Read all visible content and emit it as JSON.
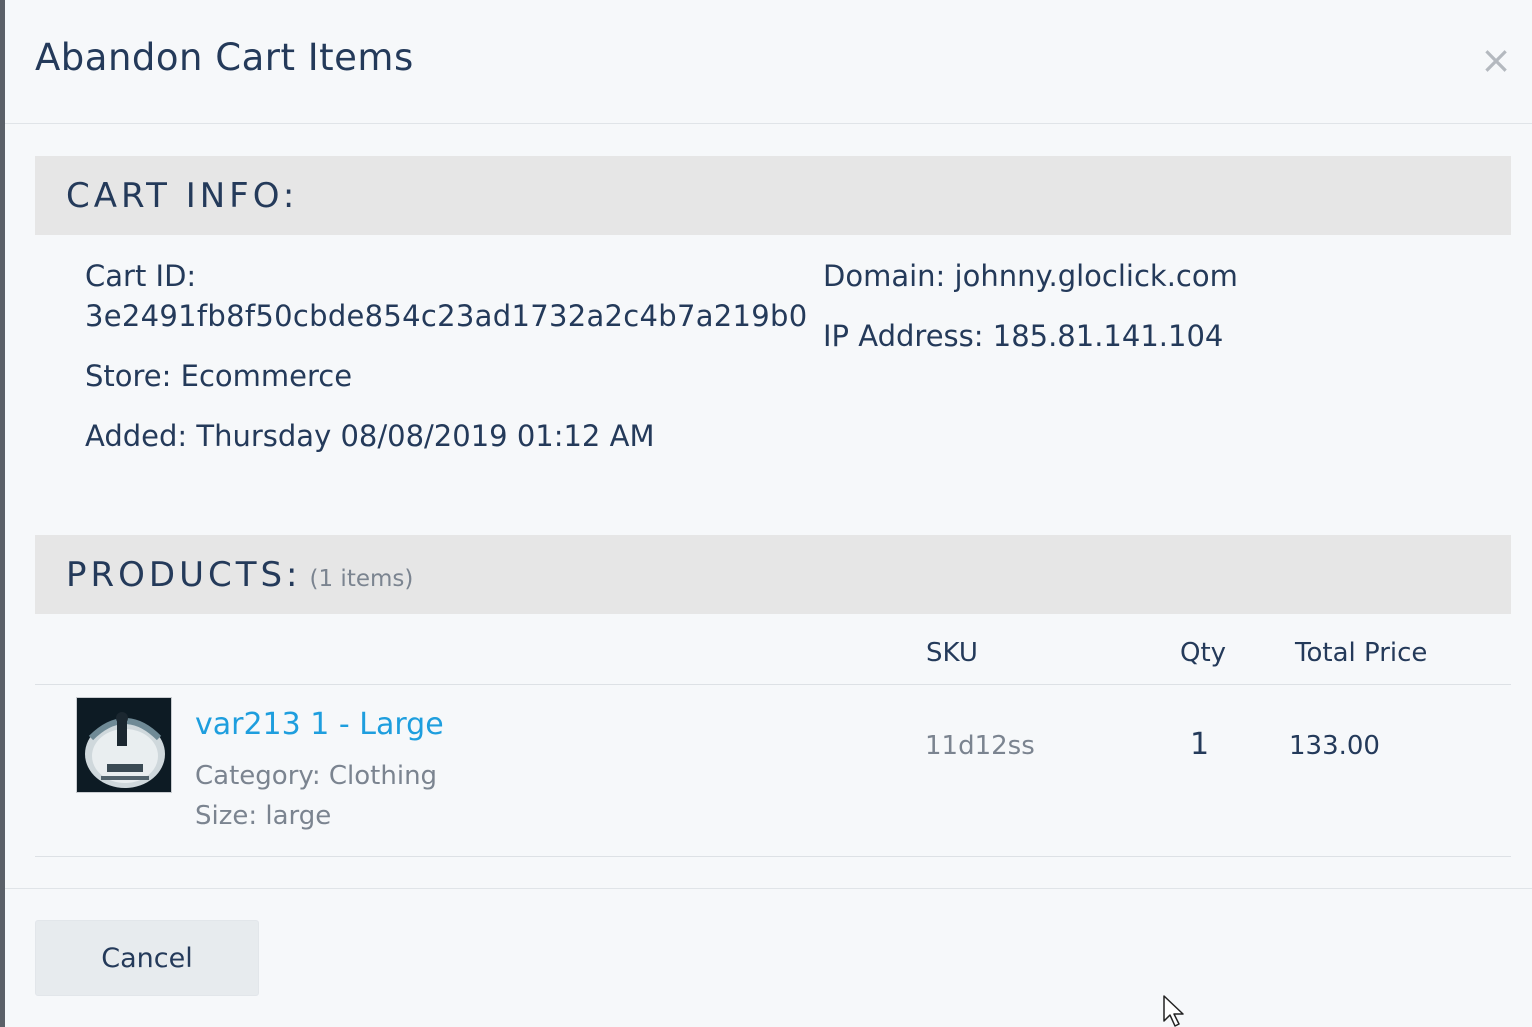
{
  "modal": {
    "title": "Abandon Cart Items",
    "close_glyph": "×"
  },
  "cart_info": {
    "heading": "CART INFO:",
    "cart_id_label": "Cart ID:",
    "cart_id_value": "3e2491fb8f50cbde854c23ad1732a2c4b7a219b0",
    "store": "Store: Ecommerce",
    "added": "Added: Thursday 08/08/2019 01:12 AM",
    "domain": "Domain: johnny.gloclick.com",
    "ip_address": "IP Address: 185.81.141.104"
  },
  "products": {
    "heading": "PRODUCTS:",
    "count_label": "(1 items)",
    "columns": {
      "sku": "SKU",
      "qty": "Qty",
      "total_price": "Total Price"
    },
    "rows": [
      {
        "name": "var213 1 - Large",
        "category": "Category: Clothing",
        "size": "Size: large",
        "sku": "11d12ss",
        "qty": "1",
        "total_price": "133.00",
        "thumbnail_icon": "product-image"
      }
    ]
  },
  "footer": {
    "cancel_label": "Cancel"
  },
  "colors": {
    "link": "#1e9ede",
    "text": "#243a5a",
    "muted": "#7b8490",
    "section_bg": "#e6e6e6"
  }
}
